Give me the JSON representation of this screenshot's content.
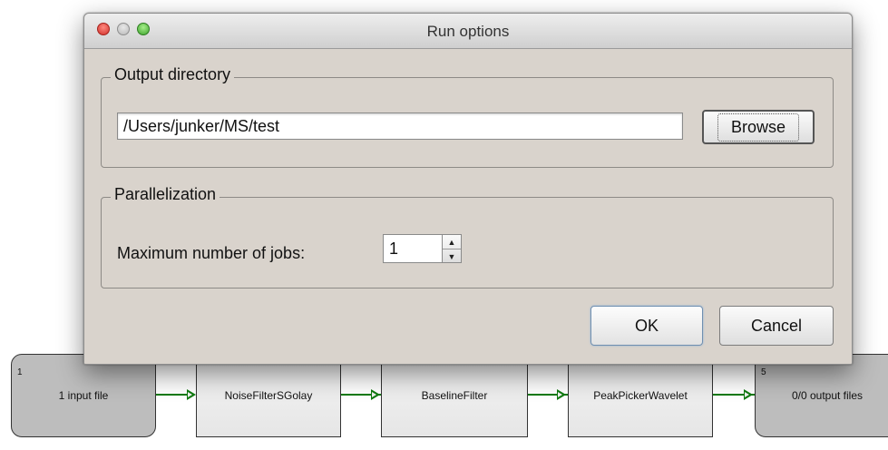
{
  "dialog": {
    "title": "Run options",
    "output_group": {
      "title": "Output directory",
      "path_value": "/Users/junker/MS/test",
      "browse_label": "Browse"
    },
    "parallel_group": {
      "title": "Parallelization",
      "jobs_label": "Maximum number of jobs:",
      "jobs_value": "1"
    },
    "ok_label": "OK",
    "cancel_label": "Cancel"
  },
  "pipeline": {
    "nodes": [
      {
        "number": "1",
        "label": "1 input file"
      },
      {
        "number": "",
        "label": "NoiseFilterSGolay"
      },
      {
        "number": "",
        "label": "BaselineFilter"
      },
      {
        "number": "",
        "label": "PeakPickerWavelet"
      },
      {
        "number": "5",
        "label": "0/0 output files"
      }
    ]
  },
  "colors": {
    "dialog_bg": "#d9d3cc",
    "edge_green": "#0f7a0f",
    "io_node_bg": "#bdbdbd"
  }
}
